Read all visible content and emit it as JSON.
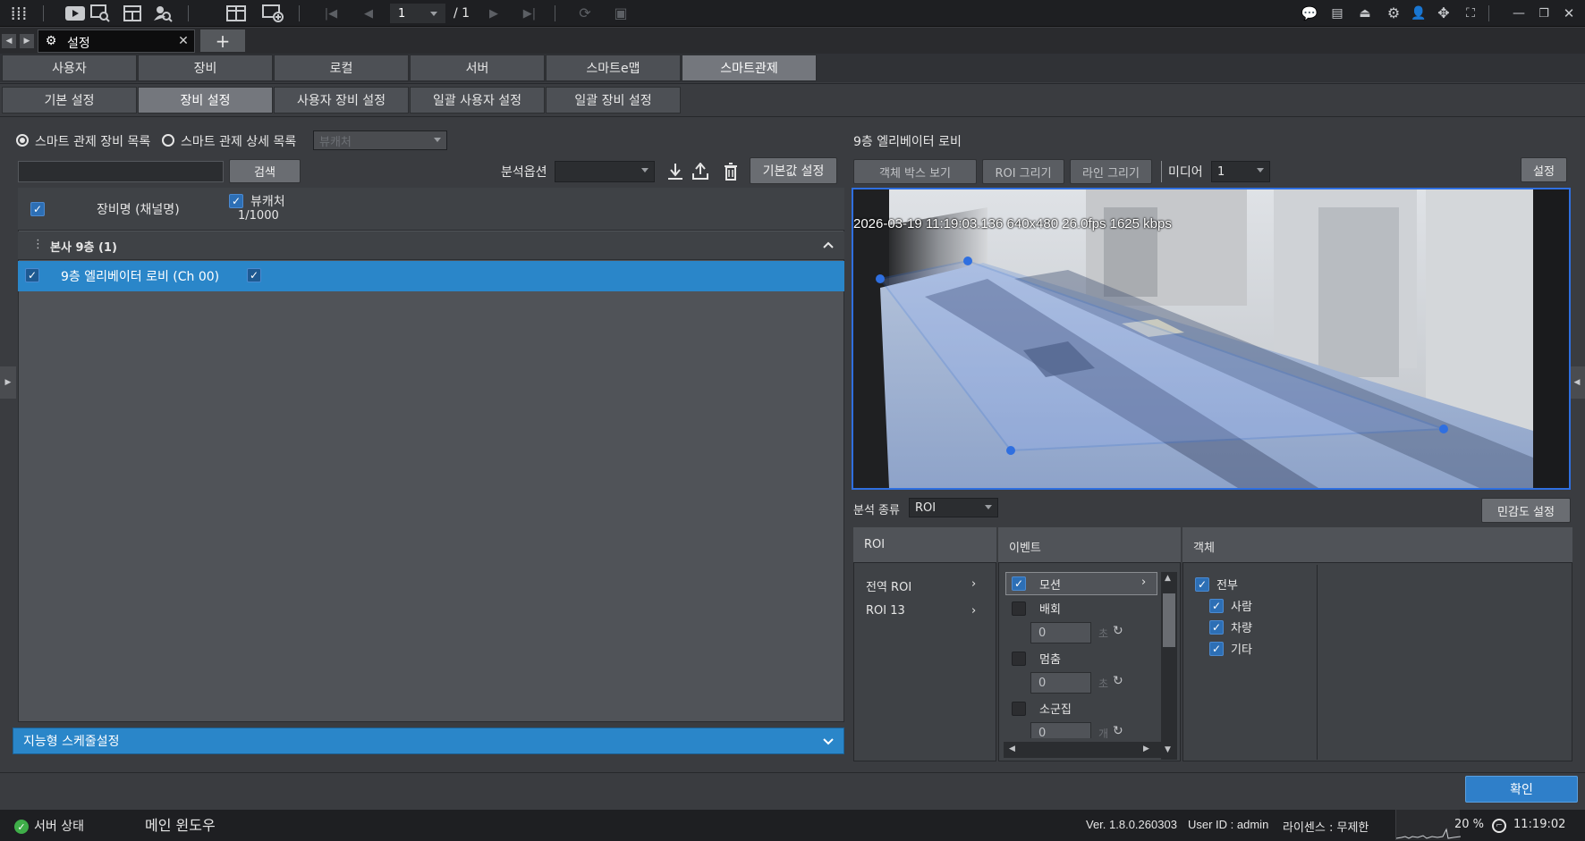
{
  "toolbar": {
    "page_current": "1",
    "page_total": "/ 1"
  },
  "window_tab": {
    "title": "설정"
  },
  "main_tabs": [
    "사용자",
    "장비",
    "로컬",
    "서버",
    "스마트e맵",
    "스마트관제"
  ],
  "sub_tabs": [
    "기본 설정",
    "장비 설정",
    "사용자 장비 설정",
    "일괄 사용자 설정",
    "일괄 장비 설정"
  ],
  "left": {
    "radio1": "스마트 관제 장비 목록",
    "radio2": "스마트 관제 상세 목록",
    "source_select": "뷰캐처",
    "search_button": "검색",
    "analysis_option_label": "분석옵션",
    "default_button": "기본값 설정",
    "col_device": "장비명 (채널명)",
    "col_viewcatcher": "뷰캐처",
    "col_count": "1/1000",
    "group": "본사 9층  (1)",
    "device_row": "9층 엘리베이터 로비 (Ch 00)",
    "schedule_bar": "지능형 스케줄설정"
  },
  "right": {
    "camera_title": "9층 엘리베이터 로비",
    "btn_object_box": "객체 박스 보기",
    "btn_roi_draw": "ROI 그리기",
    "btn_line_draw": "라인 그리기",
    "media_label": "미디어",
    "media_value": "1",
    "settings_button": "설정",
    "overlay": "2026-03-19 11:19:03.136 640x480  26.0fps 1625 kbps",
    "analysis_type_label": "분석 종류",
    "analysis_type_value": "ROI",
    "sensitivity_button": "민감도 설정",
    "roi_header": "ROI",
    "event_header": "이벤트",
    "object_header": "객체",
    "roi_items": [
      "전역 ROI",
      "ROI 13"
    ],
    "events": {
      "motion": "모션",
      "loiter": "배회",
      "loiter_val": "0",
      "loiter_unit": "초",
      "stop": "멈춤",
      "stop_val": "0",
      "stop_unit": "초",
      "crowd": "소군집",
      "crowd_val": "0",
      "crowd_unit": "개"
    },
    "objects": [
      "전부",
      "사람",
      "차량",
      "기타"
    ]
  },
  "confirm_button": "확인",
  "status": {
    "server": "서버 상태",
    "main_window": "메인 윈도우",
    "version": "Ver. 1.8.0.260303",
    "user": "User ID : admin",
    "license": "라이센스 : 무제한",
    "cpu": "20 %",
    "time": "11:19:02"
  },
  "colors": {
    "accent": "#2f7fc9",
    "selected_row": "#2a86c9",
    "roi": "#3a74e8"
  }
}
